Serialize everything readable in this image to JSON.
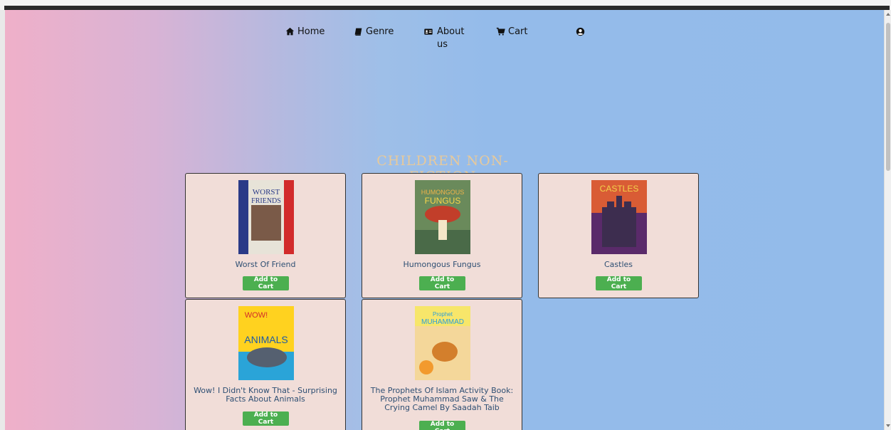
{
  "nav": {
    "items": [
      {
        "label": "Home",
        "icon": "home-icon"
      },
      {
        "label": "Genre",
        "icon": "book-icon"
      },
      {
        "label": "About us",
        "icon": "id-card-icon"
      },
      {
        "label": "Cart",
        "icon": "cart-icon"
      },
      {
        "label": "",
        "icon": "user-circle-icon"
      }
    ]
  },
  "section": {
    "title": "CHILDREN NON-FICTION"
  },
  "books": [
    {
      "title": "Worst Of Friend",
      "button": "Add to Cart",
      "cover_text": "WORST of FRIENDS",
      "cover_colors": [
        "#2a3a87",
        "#e7e3d8",
        "#d22b2b"
      ]
    },
    {
      "title": "Humongous Fungus",
      "button": "Add to Cart",
      "cover_text": "HUMONGOUS FUNGUS",
      "cover_colors": [
        "#6a8a5b",
        "#c23e2a",
        "#f0b34a"
      ]
    },
    {
      "title": "Castles",
      "button": "Add to Cart",
      "cover_text": "CASTLES",
      "cover_colors": [
        "#5a2a6a",
        "#e45b2e",
        "#f2d34a"
      ]
    },
    {
      "title": "Wow! I Didn't Know That - Surprising Facts About Animals",
      "button": "Add to Cart",
      "cover_text": "WOW! ANIMALS",
      "cover_colors": [
        "#ffd21f",
        "#1d5aa6",
        "#2aa4d8"
      ]
    },
    {
      "title": "The Prophets Of Islam Activity Book: Prophet Muhammad Saw & The Crying Camel By Saadah Taib",
      "button": "Add to Cart",
      "cover_text": "Prophet MUHAMMAD",
      "cover_colors": [
        "#f7e66a",
        "#2c9fd8",
        "#d37f2c"
      ]
    }
  ],
  "colors": {
    "card_bg": "#f1ddd8",
    "button_bg": "#4caf50",
    "title_text": "#2e4f73",
    "section_title": "#e7c99b"
  }
}
